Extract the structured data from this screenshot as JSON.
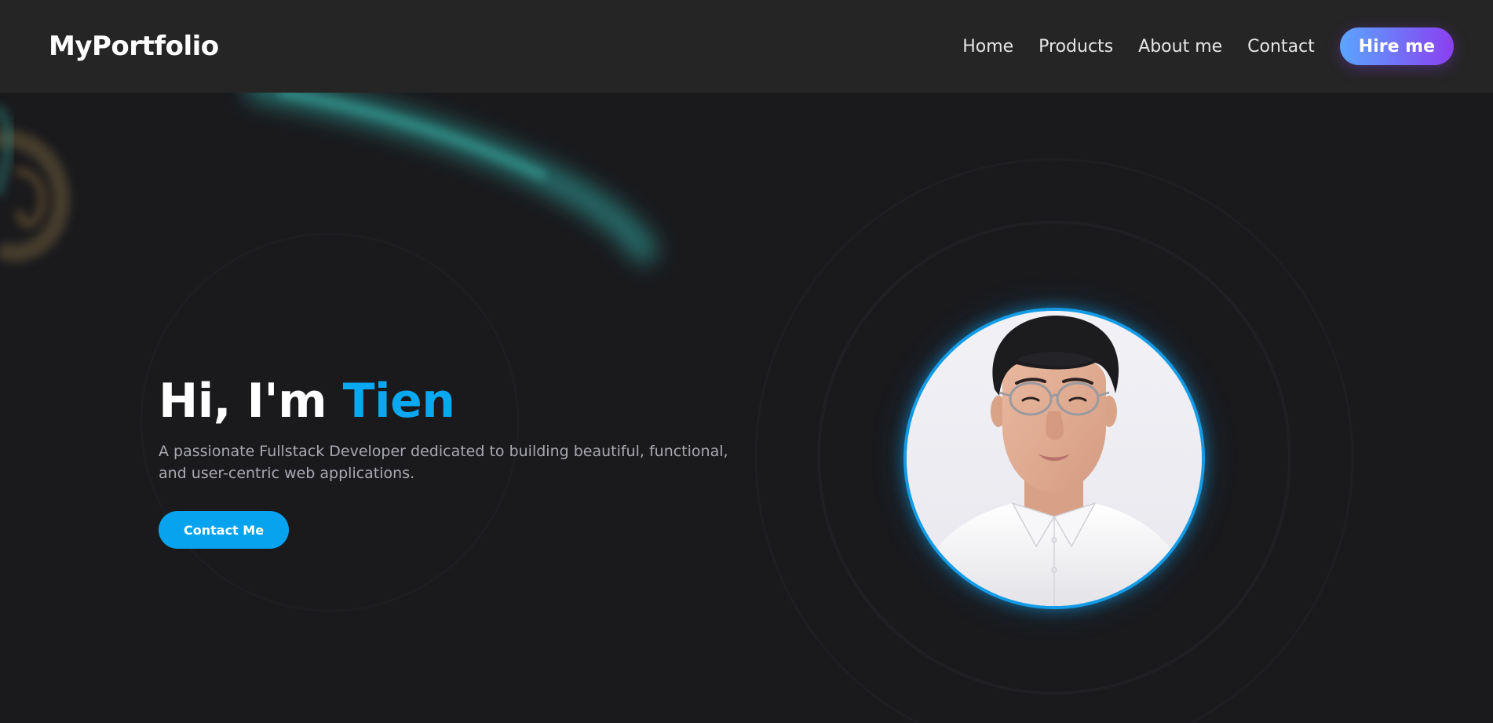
{
  "brand": "MyPortfolio",
  "nav": {
    "items": [
      {
        "label": "Home"
      },
      {
        "label": "Products"
      },
      {
        "label": "About me"
      },
      {
        "label": "Contact"
      }
    ],
    "hire_label": "Hire me"
  },
  "hero": {
    "greeting": "Hi, I'm",
    "name": "Tien",
    "description": "A passionate Fullstack Developer dedicated to building beautiful, functional, and user-centric web applications.",
    "cta_label": "Contact Me"
  },
  "colors": {
    "background": "#1a1a1d",
    "header": "#252525",
    "accent": "#0aa8f0",
    "hire_gradient_start": "#5aa6ff",
    "hire_gradient_end": "#8a3ff0"
  },
  "icons": {
    "avatar": "profile-photo"
  }
}
